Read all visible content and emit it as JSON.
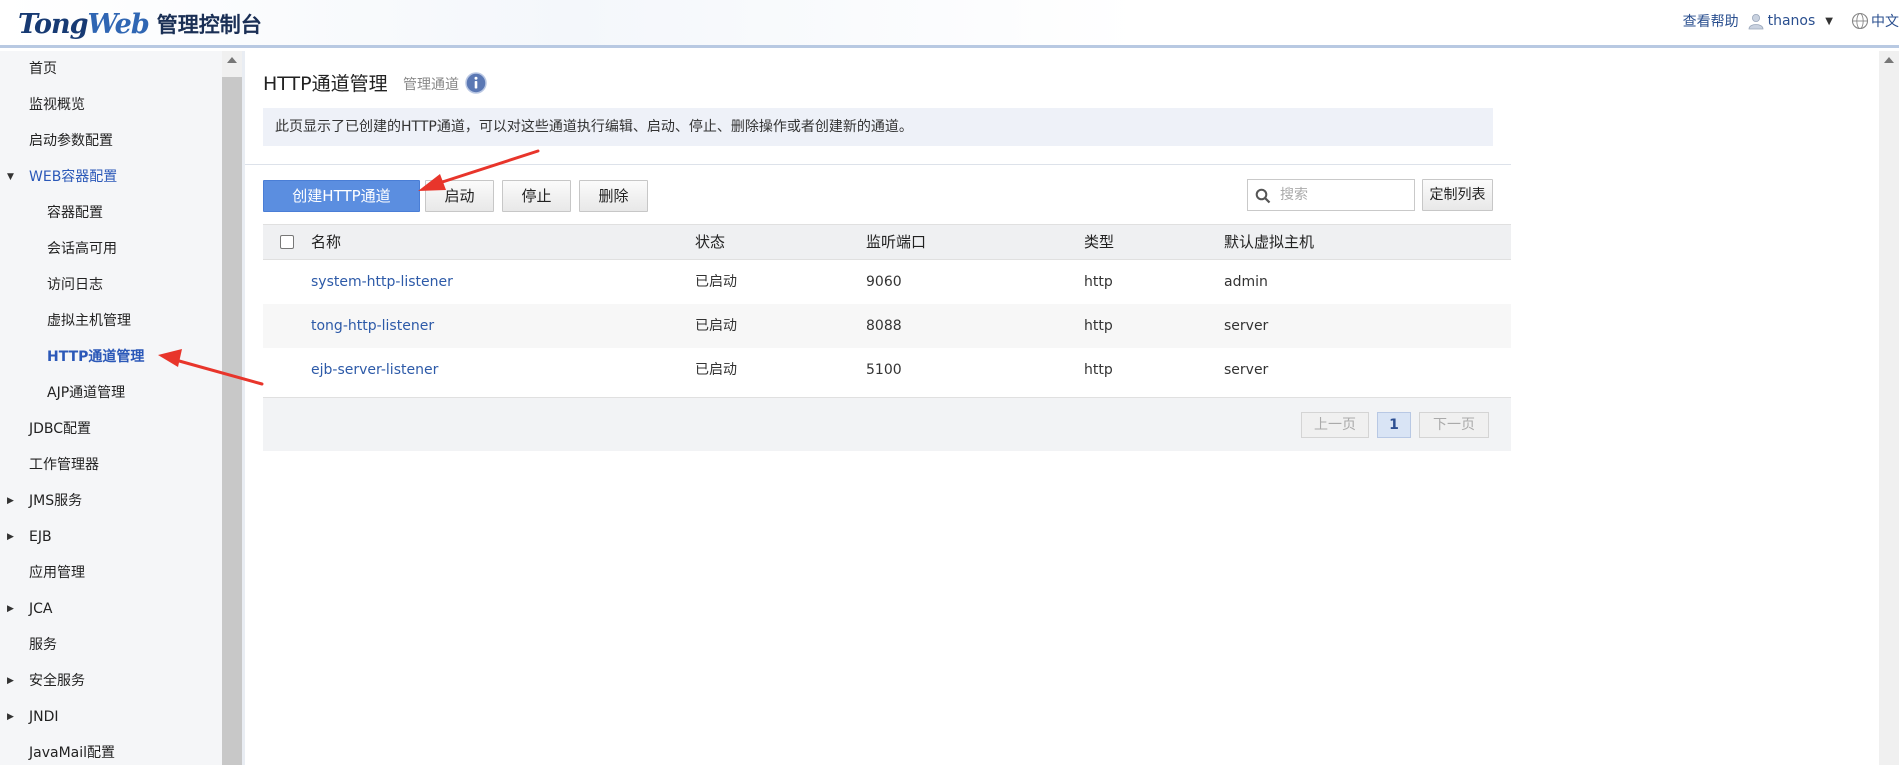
{
  "header": {
    "logo_brand_a": "Tong",
    "logo_brand_b": "Web",
    "logo_sub": "管理控制台",
    "help": "查看帮助",
    "user": "thanos",
    "language": "中文"
  },
  "sidebar": {
    "items": [
      {
        "label": "首页"
      },
      {
        "label": "监视概览"
      },
      {
        "label": "启动参数配置"
      },
      {
        "label": "WEB容器配置",
        "expanded": true
      },
      {
        "label": "容器配置"
      },
      {
        "label": "会话高可用"
      },
      {
        "label": "访问日志"
      },
      {
        "label": "虚拟主机管理"
      },
      {
        "label": "HTTP通道管理",
        "active": true
      },
      {
        "label": "AJP通道管理"
      },
      {
        "label": "JDBC配置"
      },
      {
        "label": "工作管理器"
      },
      {
        "label": "JMS服务"
      },
      {
        "label": "EJB"
      },
      {
        "label": "应用管理"
      },
      {
        "label": "JCA"
      },
      {
        "label": "服务"
      },
      {
        "label": "安全服务"
      },
      {
        "label": "JNDI"
      },
      {
        "label": "JavaMail配置"
      }
    ]
  },
  "main": {
    "title": "HTTP通道管理",
    "subtitle": "管理通道",
    "description": "此页显示了已创建的HTTP通道，可以对这些通道执行编辑、启动、停止、删除操作或者创建新的通道。",
    "buttons": {
      "create": "创建HTTP通道",
      "start": "启动",
      "stop": "停止",
      "delete": "删除",
      "customize": "定制列表"
    },
    "search": {
      "placeholder": "搜索",
      "value": ""
    },
    "table": {
      "headers": [
        "名称",
        "状态",
        "监听端口",
        "类型",
        "默认虚拟主机"
      ],
      "rows": [
        {
          "name": "system-http-listener",
          "status": "已启动",
          "port": "9060",
          "type": "http",
          "vhost": "admin"
        },
        {
          "name": "tong-http-listener",
          "status": "已启动",
          "port": "8088",
          "type": "http",
          "vhost": "server"
        },
        {
          "name": "ejb-server-listener",
          "status": "已启动",
          "port": "5100",
          "type": "http",
          "vhost": "server"
        }
      ]
    },
    "pager": {
      "prev": "上一页",
      "current": "1",
      "next": "下一页"
    }
  },
  "colors": {
    "accent": "#5b8ee0",
    "annotation": "#e8352b",
    "link": "#2d5aa8"
  }
}
